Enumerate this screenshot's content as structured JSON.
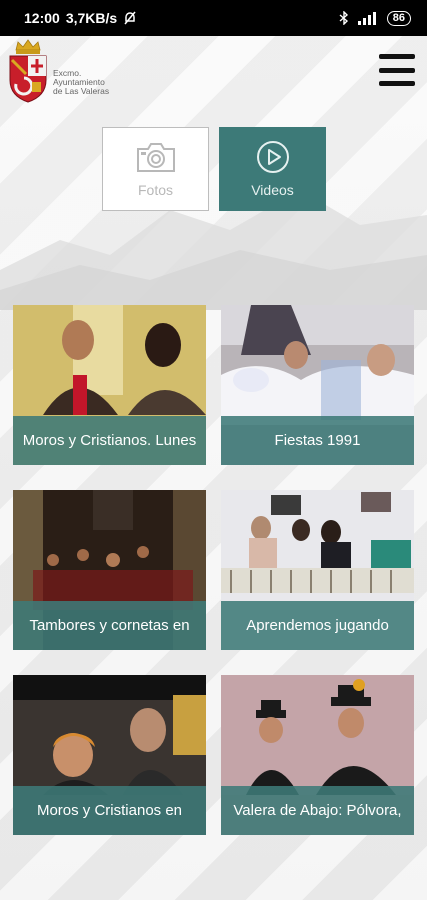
{
  "status_bar": {
    "time": "12:00",
    "speed": "3,7KB/s",
    "battery": "86"
  },
  "header": {
    "logo_text_line1": "Excmo.",
    "logo_text_line2": "Ayuntamiento",
    "logo_text_line3": "de Las Valeras"
  },
  "tabs": [
    {
      "label": "Fotos",
      "icon": "camera-icon",
      "active": false
    },
    {
      "label": "Videos",
      "icon": "play-icon",
      "active": true
    }
  ],
  "videos": [
    {
      "title": "Moros y Cristianos. Lunes"
    },
    {
      "title": "Fiestas 1991"
    },
    {
      "title": "Tambores y cornetas en"
    },
    {
      "title": "Aprendemos jugando"
    },
    {
      "title": "Moros y Cristianos en"
    },
    {
      "title": "Valera de Abajo: Pólvora,"
    }
  ],
  "colors": {
    "accent": "#3d7a78",
    "status_bar": "#000000",
    "menu_icon": "#111111"
  }
}
